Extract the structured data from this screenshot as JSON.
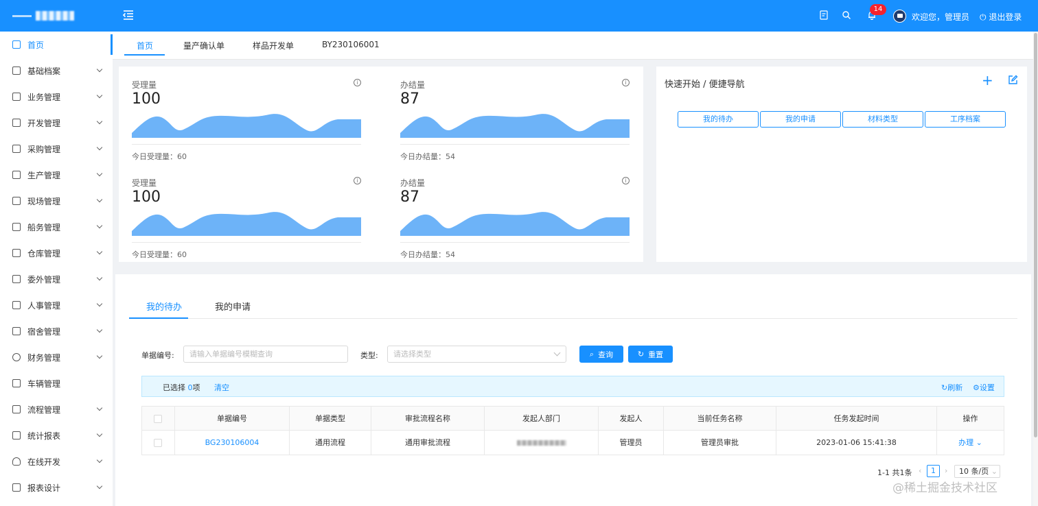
{
  "header": {
    "welcome": "欢迎您，管理员",
    "logout": "退出登录",
    "notification_count": "14"
  },
  "sidebar": {
    "items": [
      {
        "label": "首页"
      },
      {
        "label": "基础档案"
      },
      {
        "label": "业务管理"
      },
      {
        "label": "开发管理"
      },
      {
        "label": "采购管理"
      },
      {
        "label": "生产管理"
      },
      {
        "label": "现场管理"
      },
      {
        "label": "船务管理"
      },
      {
        "label": "仓库管理"
      },
      {
        "label": "委外管理"
      },
      {
        "label": "人事管理"
      },
      {
        "label": "宿舍管理"
      },
      {
        "label": "财务管理"
      },
      {
        "label": "车辆管理"
      },
      {
        "label": "流程管理"
      },
      {
        "label": "统计报表"
      },
      {
        "label": "在线开发"
      },
      {
        "label": "报表设计"
      }
    ]
  },
  "page_tabs": [
    "首页",
    "量产确认单",
    "样品开发单",
    "BY230106001"
  ],
  "stats": [
    {
      "label": "受理量",
      "value": "100",
      "sub": "今日受理量：60"
    },
    {
      "label": "办结量",
      "value": "87",
      "sub": "今日办结量：54"
    },
    {
      "label": "受理量",
      "value": "100",
      "sub": "今日受理量：60"
    },
    {
      "label": "办结量",
      "value": "87",
      "sub": "今日办结量：54"
    }
  ],
  "quick_nav": {
    "title": "快速开始 / 便捷导航",
    "buttons": [
      "我的待办",
      "我的申请",
      "材料类型",
      "工序档案"
    ]
  },
  "lower_tabs": [
    "我的待办",
    "我的申请"
  ],
  "filters": {
    "code_label": "单据编号:",
    "code_placeholder": "请输入单据编号模糊查询",
    "type_label": "类型:",
    "type_placeholder": "请选择类型",
    "query_label": "查询",
    "reset_label": "重置"
  },
  "selection": {
    "prefix": "已选择",
    "count": "0",
    "suffix": "项",
    "clear": "清空",
    "refresh": "刷新",
    "settings": "设置"
  },
  "table": {
    "columns": [
      "单据编号",
      "单据类型",
      "审批流程名称",
      "发起人部门",
      "发起人",
      "当前任务名称",
      "任务发起时间",
      "操作"
    ],
    "rows": [
      {
        "code": "BG230106004",
        "type": "通用流程",
        "flow": "通用审批流程",
        "initiator": "管理员",
        "task": "管理员审批",
        "time": "2023-01-06 15:41:38",
        "action": "办理"
      }
    ]
  },
  "pagination": {
    "total": "1-1 共1条",
    "current_page": "1",
    "page_size": "10 条/页"
  },
  "watermark": "@稀土掘金技术社区",
  "colors": {
    "primary": "#1890ff",
    "badge": "#f5222d",
    "area": "#6db3f8"
  }
}
